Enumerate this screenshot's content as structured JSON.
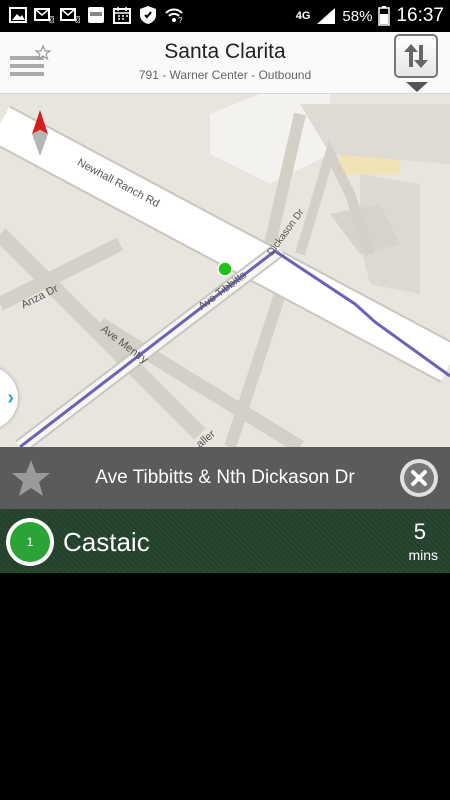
{
  "status_bar": {
    "network": "4G",
    "battery_percent": "58%",
    "time": "16:37",
    "icons_left": [
      "image-icon",
      "mail-icon",
      "mail-icon",
      "galaxy-app-icon",
      "calendar-icon",
      "shield-icon",
      "wifi-question-icon"
    ]
  },
  "header": {
    "title": "Santa Clarita",
    "subtitle": "791 - Warner Center - Outbound"
  },
  "map": {
    "labels": {
      "newhall_ranch": "Newhall Ranch Rd",
      "anza": "Anza Dr",
      "ave_mentry": "Ave Mentry",
      "ave_tibbitts": "Ave Tibbitts",
      "dickason": "Dickason Dr",
      "other": "aller"
    },
    "colors": {
      "route": "#6a62b8",
      "vehicle": "#22c01a",
      "compass_red": "#d22020"
    }
  },
  "stop": {
    "name": "Ave Tibbitts & Nth Dickason Dr"
  },
  "arrival": {
    "route_number": "1",
    "destination": "Castaic",
    "eta_value": "5",
    "eta_unit": "mins"
  },
  "colors": {
    "header_bg": "#fafafa",
    "stopbar_bg": "#5b5b5b",
    "arrival_bg": "#22402a",
    "route_badge": "#2aa337",
    "side_tab_arrow": "#33a3d6"
  }
}
